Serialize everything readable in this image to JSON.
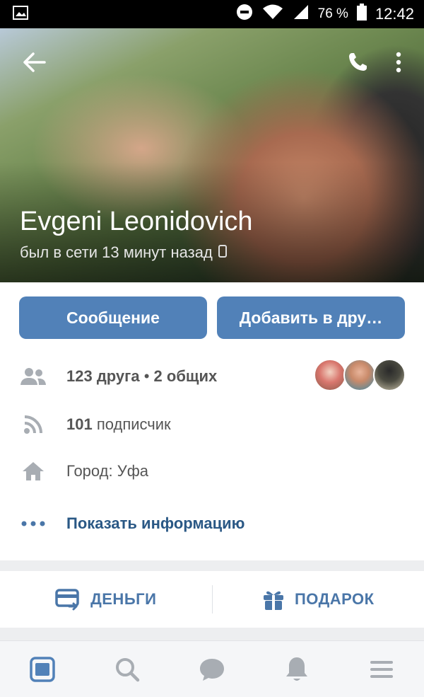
{
  "status_bar": {
    "battery_percent": "76 %",
    "time": "12:42",
    "icons": [
      "image-icon",
      "do-not-disturb-icon",
      "wifi-icon",
      "signal-icon",
      "battery-icon"
    ]
  },
  "profile": {
    "name": "Evgeni Leonidovich",
    "last_seen": "был в сети 13 минут назад"
  },
  "actions": {
    "message_label": "Сообщение",
    "add_friend_label": "Добавить в дру…"
  },
  "info": {
    "friends_count": "123 друга",
    "mutual_count": "2 общих",
    "separator": "•",
    "followers_count": "101",
    "followers_label": "подписчик",
    "city": "Город: Уфа",
    "show_info": "Показать информацию"
  },
  "extras": {
    "money_label": "ДЕНЬГИ",
    "gift_label": "ПОДАРОК"
  },
  "bottom_nav": [
    "news-icon",
    "search-icon",
    "messages-icon",
    "notifications-icon",
    "menu-icon"
  ],
  "colors": {
    "accent": "#5181b8",
    "link": "#2a5885",
    "icon_gray": "#a8adb3",
    "icon_blue": "#4a76a8",
    "background": "#edeef0"
  }
}
